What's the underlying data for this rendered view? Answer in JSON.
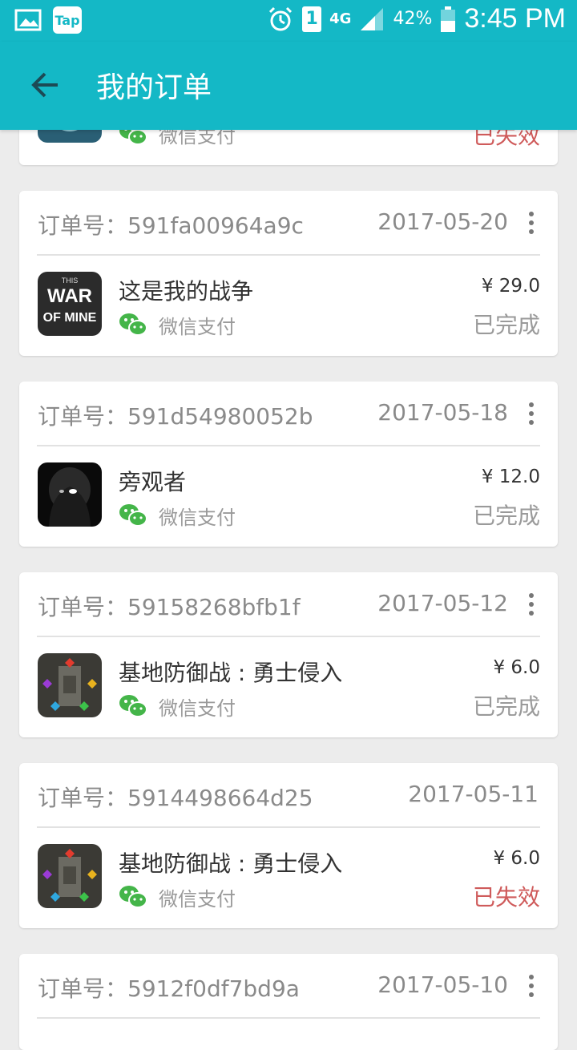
{
  "status_bar": {
    "time": "3:45 PM",
    "battery_percent": "42%",
    "network": "4G",
    "sim": "1",
    "app_badge": "Tap"
  },
  "header": {
    "title": "我的订单"
  },
  "colors": {
    "primary": "#14b8c6",
    "invalid": "#cf5b5b",
    "wechat_green": "#44b549"
  },
  "orders": [
    {
      "order_label": "",
      "order_id": "",
      "date": "",
      "game": "",
      "payment": "微信支付",
      "price": "",
      "status": "已失效"
    },
    {
      "order_label": "订单号：",
      "order_id": "591fa00964a9c",
      "date": "2017-05-20",
      "game": "这是我的战争",
      "payment": "微信支付",
      "price": "¥ 29.0",
      "status": "已完成"
    },
    {
      "order_label": "订单号：",
      "order_id": "591d54980052b",
      "date": "2017-05-18",
      "game": "旁观者",
      "payment": "微信支付",
      "price": "¥ 12.0",
      "status": "已完成"
    },
    {
      "order_label": "订单号：",
      "order_id": "59158268bfb1f",
      "date": "2017-05-12",
      "game": "基地防御战 : 勇士侵入",
      "payment": "微信支付",
      "price": "¥ 6.0",
      "status": "已完成"
    },
    {
      "order_label": "订单号：",
      "order_id": "5914498664d25",
      "date": "2017-05-11",
      "game": "基地防御战 : 勇士侵入",
      "payment": "微信支付",
      "price": "¥ 6.0",
      "status": "已失效"
    },
    {
      "order_label": "订单号：",
      "order_id": "5912f0df7bd9a",
      "date": "2017-05-10",
      "game": "",
      "payment": "",
      "price": "",
      "status": ""
    }
  ],
  "icon_text": {
    "war_of_mine_line1": "THIS",
    "war_of_mine_line2": "WAR",
    "war_of_mine_line3": "OF MINE"
  }
}
